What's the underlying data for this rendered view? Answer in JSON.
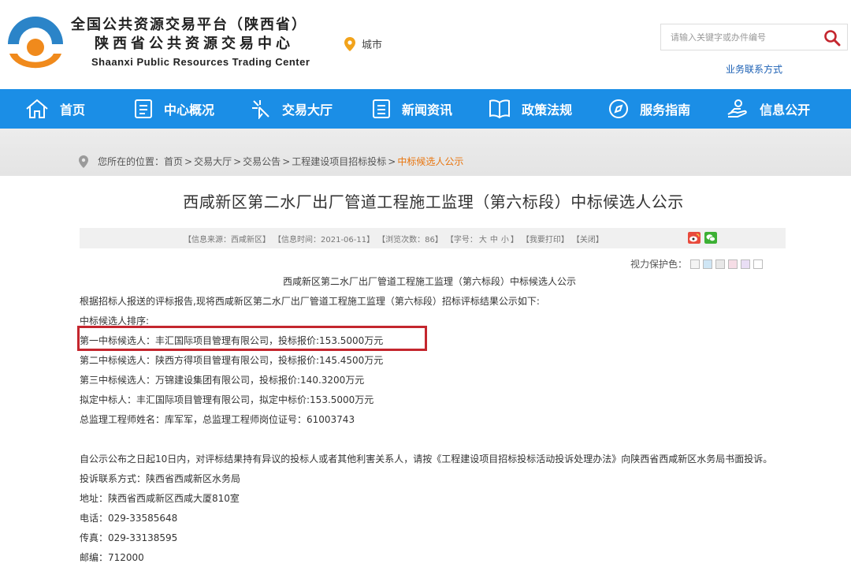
{
  "header": {
    "brand_cn_line1": "全国公共资源交易平台（陕西省）",
    "brand_cn_line2": "陕西省公共资源交易中心",
    "brand_en": "Shaanxi Public Resources Trading Center",
    "city_label": "城市",
    "search_placeholder": "请输入关键字或办件编号",
    "contact_link": "业务联系方式"
  },
  "nav": [
    {
      "label": "首页",
      "icon": "home-icon"
    },
    {
      "label": "中心概况",
      "icon": "document-icon"
    },
    {
      "label": "交易大厅",
      "icon": "trade-hall-icon"
    },
    {
      "label": "新闻资讯",
      "icon": "news-icon"
    },
    {
      "label": "政策法规",
      "icon": "book-icon"
    },
    {
      "label": "服务指南",
      "icon": "compass-icon"
    },
    {
      "label": "信息公开",
      "icon": "hand-icon"
    }
  ],
  "breadcrumb": {
    "prefix": "您所在的位置：",
    "items": [
      "首页",
      "交易大厅",
      "交易公告",
      "工程建设项目招标投标"
    ],
    "current": "中标候选人公示",
    "separator": ">"
  },
  "article": {
    "title": "西咸新区第二水厂出厂管道工程施工监理（第六标段）中标候选人公示",
    "meta": {
      "source": "【信息来源：西咸新区】",
      "time": "【信息时间：2021-06-11】",
      "views": "【浏览次数：86】",
      "font_label": "【字号：",
      "font_large": "大",
      "font_medium": "中",
      "font_small": "小",
      "font_close": "】",
      "print": "【我要打印】",
      "close": "【关闭】"
    },
    "eye_protection_label": "视力保护色：",
    "eye_colors": [
      "#f4f4f4",
      "#cfe6f5",
      "#e8e8e8",
      "#f6dde6",
      "#e9def5",
      "#ffffff"
    ],
    "highlight_color": "#c4262e",
    "lines": [
      "西咸新区第二水厂出厂管道工程施工监理（第六标段）中标候选人公示",
      "根据招标人报送的评标报告,现将西咸新区第二水厂出厂管道工程施工监理（第六标段）招标评标结果公示如下:",
      "中标候选人排序:",
      "第一中标候选人：丰汇国际项目管理有限公司，投标报价:153.5000万元",
      "第二中标候选人：陕西方得项目管理有限公司，投标报价:145.4500万元",
      "第三中标候选人：万锦建设集团有限公司，投标报价:140.3200万元",
      "拟定中标人：丰汇国际项目管理有限公司，拟定中标价:153.5000万元",
      "总监理工程师姓名：库军军，总监理工程师岗位证号：61003743",
      "自公示公布之日起10日内，对评标结果持有异议的投标人或者其他利害关系人，请按《工程建设项目招标投标活动投诉处理办法》向陕西省西咸新区水务局书面投诉。",
      "投诉联系方式：陕西省西咸新区水务局",
      "地址：陕西省西咸新区西咸大厦810室",
      "电话：029-33585648",
      "传真：029-33138595",
      "邮编：712000"
    ]
  }
}
